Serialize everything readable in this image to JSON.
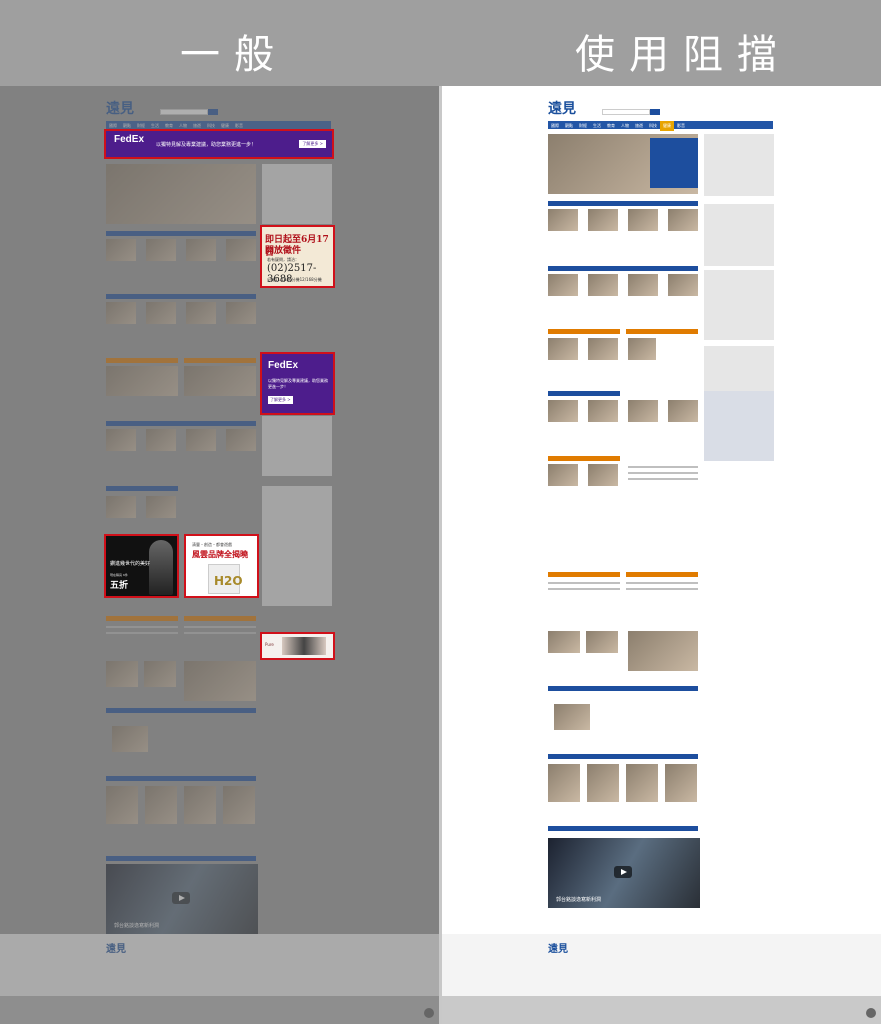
{
  "header": {
    "left_title": "一般",
    "right_title": "使用阻擋"
  },
  "site": {
    "logo": "遠見",
    "nav_items": [
      "國際",
      "觀點",
      "財經",
      "生活",
      "教育",
      "人物",
      "旅遊",
      "科技",
      "健康",
      "影音"
    ]
  },
  "ads": {
    "fedex_wide": {
      "brand": "FedEx",
      "express": "Express",
      "message": "以獨特見解及專業建議，助您業務更進一步！",
      "button": "了解更多 >"
    },
    "store": {
      "line1": "即日起至6月17日",
      "line2": "開放徵件",
      "line3": "若有疑問，請洽：",
      "phone": "(02)2517-3688",
      "line5": "分機11/1486分機12/168分機"
    },
    "fedex_square": {
      "brand": "FedEx",
      "express": "Express",
      "message": "以獨特見解及專業建議，助您業務更進一步！",
      "button": "了解更多 >"
    },
    "jewel": {
      "line1": "鑽進幾世代的美好",
      "line2": "現在購買 6件",
      "line3": "五折"
    },
    "brand": {
      "line1": "清豐・創造・都會遊戲",
      "line2": "風雲品牌",
      "line3": "全揭曉",
      "mark": "H2O"
    },
    "small": {
      "label": "Pure"
    }
  },
  "video": {
    "caption": "郭台銘談逸寫新利潤"
  },
  "footer": {
    "logo": "遠見"
  }
}
